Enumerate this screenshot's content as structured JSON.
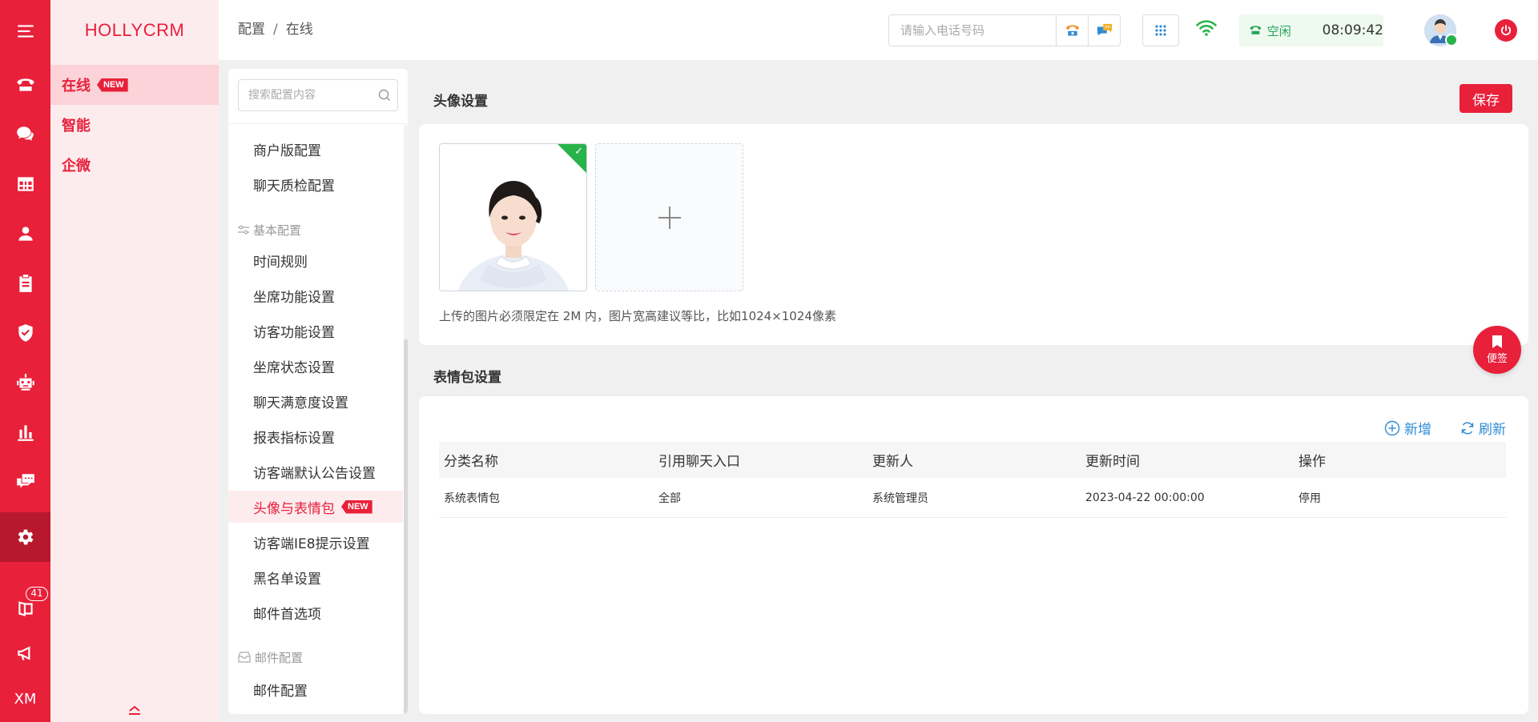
{
  "app": {
    "brand": "HOLLYCRM"
  },
  "rail": {
    "badge_count": "41",
    "footer_label": "XM"
  },
  "side_menu": [
    {
      "label": "在线",
      "badge": "NEW",
      "active": true
    },
    {
      "label": "智能"
    },
    {
      "label": "企微"
    }
  ],
  "header": {
    "breadcrumb": [
      "配置",
      "在线"
    ],
    "phone_placeholder": "请输入电话号码",
    "agent_status": "空闲",
    "clock": "08:09:42"
  },
  "config_menu": {
    "search_placeholder": "搜索配置内容",
    "items_top": [
      "商户版配置",
      "聊天质检配置"
    ],
    "group_basic": "基本配置",
    "items_basic": [
      "时间规则",
      "坐席功能设置",
      "访客功能设置",
      "坐席状态设置",
      "聊天满意度设置",
      "报表指标设置",
      "访客端默认公告设置",
      "头像与表情包",
      "访客端IE8提示设置",
      "黑名单设置",
      "邮件首选项"
    ],
    "active_item": "头像与表情包",
    "active_badge": "NEW",
    "group_mail": "邮件配置",
    "items_mail": [
      "邮件配置"
    ]
  },
  "avatar_section": {
    "title": "头像设置",
    "save_label": "保存",
    "hint": "上传的图片必须限定在 2M 内，图片宽高建议等比，比如1024×1024像素"
  },
  "emoji_section": {
    "title": "表情包设置",
    "add_label": "新增",
    "refresh_label": "刷新",
    "columns": [
      "分类名称",
      "引用聊天入口",
      "更新人",
      "更新时间",
      "操作"
    ],
    "rows": [
      {
        "name": "系统表情包",
        "entry": "全部",
        "updater": "系统管理员",
        "time": "2023-04-22 00:00:00",
        "action": "停用"
      }
    ]
  },
  "sticky_note": {
    "label": "便签"
  },
  "colors": {
    "primary": "#e8203a",
    "rail_active": "#b8182d",
    "link": "#2f8bd6",
    "success": "#28b34b"
  }
}
